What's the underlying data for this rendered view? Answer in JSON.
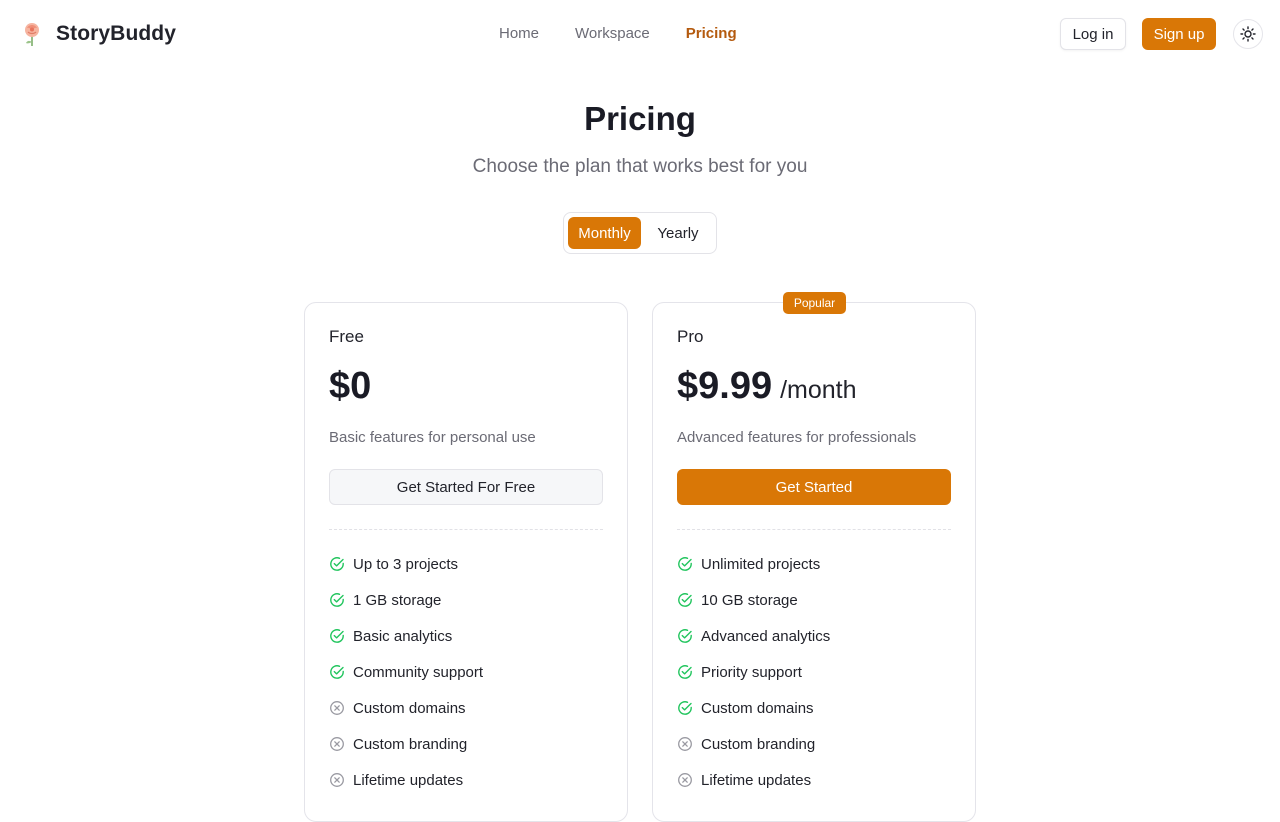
{
  "header": {
    "brand": "StoryBuddy",
    "nav": [
      {
        "label": "Home",
        "active": false
      },
      {
        "label": "Workspace",
        "active": false
      },
      {
        "label": "Pricing",
        "active": true
      }
    ],
    "login_label": "Log in",
    "signup_label": "Sign up",
    "theme_icon": "sun-icon"
  },
  "hero": {
    "title": "Pricing",
    "subtitle": "Choose the plan that works best for you"
  },
  "billing_toggle": {
    "options": [
      "Monthly",
      "Yearly"
    ],
    "selected": "Monthly"
  },
  "colors": {
    "accent": "#d97706",
    "nav_active": "#b45a0e",
    "check": "#22c55e",
    "cross": "#9a9aa2"
  },
  "plans": [
    {
      "name": "Free",
      "price": "$0",
      "period": "",
      "description": "Basic features for personal use",
      "cta": "Get Started For Free",
      "badge": "",
      "features": [
        {
          "label": "Up to 3 projects",
          "included": true
        },
        {
          "label": "1 GB storage",
          "included": true
        },
        {
          "label": "Basic analytics",
          "included": true
        },
        {
          "label": "Community support",
          "included": true
        },
        {
          "label": "Custom domains",
          "included": false
        },
        {
          "label": "Custom branding",
          "included": false
        },
        {
          "label": "Lifetime updates",
          "included": false
        }
      ]
    },
    {
      "name": "Pro",
      "price": "$9.99",
      "period": "/month",
      "description": "Advanced features for professionals",
      "cta": "Get Started",
      "badge": "Popular",
      "features": [
        {
          "label": "Unlimited projects",
          "included": true
        },
        {
          "label": "10 GB storage",
          "included": true
        },
        {
          "label": "Advanced analytics",
          "included": true
        },
        {
          "label": "Priority support",
          "included": true
        },
        {
          "label": "Custom domains",
          "included": true
        },
        {
          "label": "Custom branding",
          "included": false
        },
        {
          "label": "Lifetime updates",
          "included": false
        }
      ]
    }
  ]
}
